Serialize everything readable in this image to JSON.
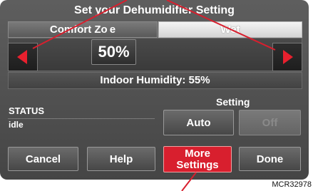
{
  "title": "Set your Dehumidifier Setting",
  "tabs": [
    {
      "label": "Comfort Zo e"
    },
    {
      "label": "Wet"
    }
  ],
  "setpoint": "50%",
  "indoor_humidity": "Indoor Humidity: 55%",
  "status": {
    "heading": "STATUS",
    "value": "idle"
  },
  "setting": {
    "heading": "Setting",
    "auto_label": "Auto",
    "off_label": "Off"
  },
  "bottom_buttons": {
    "cancel": "Cancel",
    "help": "Help",
    "more_line1": "More",
    "more_line2": "Settings",
    "done": "Done"
  },
  "caption": "MCR32978",
  "colors": {
    "accent_red": "#d81f2e",
    "screen_bg": "#4d4d4d"
  },
  "icons": {
    "decrease": "left-arrow-icon",
    "increase": "right-arrow-icon"
  }
}
